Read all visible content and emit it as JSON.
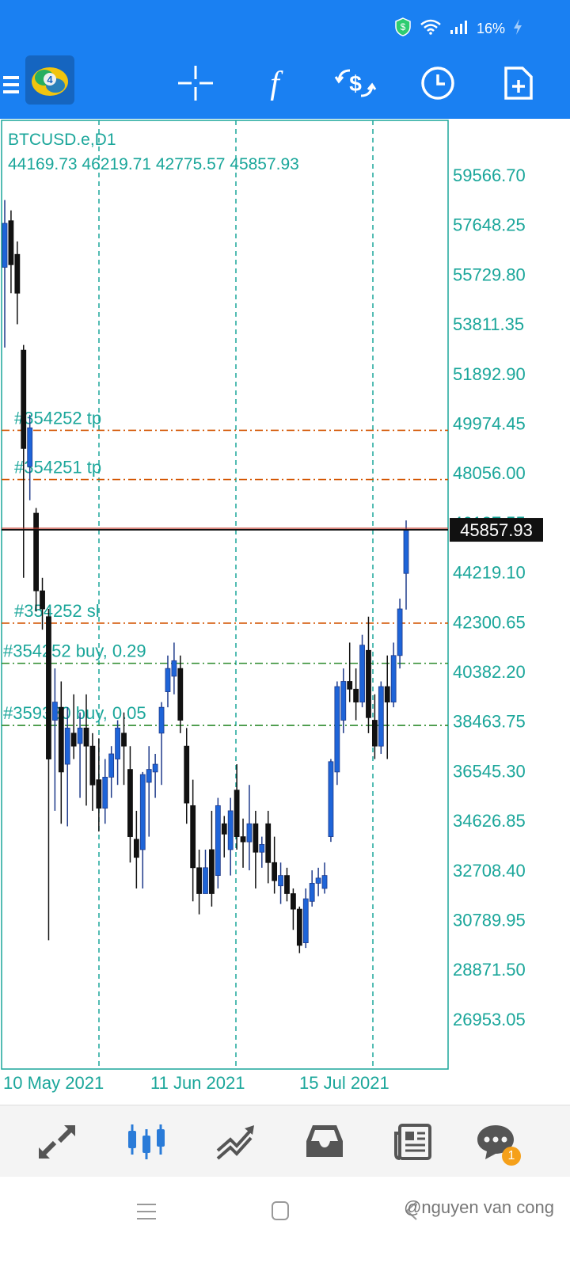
{
  "status_bar": {
    "battery": "16%"
  },
  "chart": {
    "symbol": "BTCUSD.e,D1",
    "ohlc": "44169.73 46219.71 42775.57 45857.93",
    "price_labels": [
      "59566.70",
      "57648.25",
      "55729.80",
      "53811.35",
      "51892.90",
      "49974.45",
      "48056.00",
      "46137.55",
      "44219.10",
      "42300.65",
      "40382.20",
      "38463.75",
      "36545.30",
      "34626.85",
      "32708.40",
      "30789.95",
      "28871.50",
      "26953.05"
    ],
    "current_price": "45857.93",
    "date_labels": [
      "10 May 2021",
      "11 Jun 2021",
      "15 Jul 2021"
    ],
    "trade_lines": [
      {
        "label": "#354252 tp",
        "kind": "tp"
      },
      {
        "label": "#354251 tp",
        "kind": "tp"
      },
      {
        "label": "#354252 sl",
        "kind": "sl"
      },
      {
        "label": "#354252 buy, 0.29",
        "kind": "entry"
      },
      {
        "label": "#359380 buy, 0.05",
        "kind": "entry"
      }
    ],
    "colors": {
      "axis": "#1aa69a",
      "bull": "#1e64d8",
      "bear": "#111111",
      "tp": "#d35400",
      "entry": "#2e8b2e",
      "price_line": "#c0392b"
    }
  },
  "chart_data": {
    "type": "candlestick",
    "title": "BTCUSD.e,D1",
    "xlabel": "",
    "ylabel": "",
    "ylim": [
      25000,
      61500
    ],
    "x_ticks": [
      "10 May 2021",
      "11 Jun 2021",
      "15 Jul 2021"
    ],
    "y_ticks": [
      59566.7,
      57648.25,
      55729.8,
      53811.35,
      51892.9,
      49974.45,
      48056.0,
      46137.55,
      44219.1,
      42300.65,
      40382.2,
      38463.75,
      36545.3,
      34626.85,
      32708.4,
      30789.95,
      28871.5,
      26953.05
    ],
    "last_price": 45857.93,
    "grid": true,
    "candles": [
      {
        "o": 56000,
        "h": 58600,
        "l": 52900,
        "c": 57700
      },
      {
        "o": 57800,
        "h": 58200,
        "l": 55000,
        "c": 56100
      },
      {
        "o": 56500,
        "h": 57000,
        "l": 53800,
        "c": 55000
      },
      {
        "o": 52800,
        "h": 53000,
        "l": 44000,
        "c": 49000
      },
      {
        "o": 48300,
        "h": 50300,
        "l": 47000,
        "c": 49800
      },
      {
        "o": 46500,
        "h": 46700,
        "l": 42700,
        "c": 43500
      },
      {
        "o": 43500,
        "h": 44000,
        "l": 42000,
        "c": 42800
      },
      {
        "o": 42500,
        "h": 42800,
        "l": 30000,
        "c": 37000
      },
      {
        "o": 38500,
        "h": 40500,
        "l": 35000,
        "c": 39200
      },
      {
        "o": 39000,
        "h": 40000,
        "l": 34500,
        "c": 36500
      },
      {
        "o": 36800,
        "h": 39000,
        "l": 34400,
        "c": 38200
      },
      {
        "o": 38000,
        "h": 39500,
        "l": 37000,
        "c": 37500
      },
      {
        "o": 37600,
        "h": 38800,
        "l": 35500,
        "c": 38200
      },
      {
        "o": 38200,
        "h": 39500,
        "l": 35200,
        "c": 37500
      },
      {
        "o": 37500,
        "h": 38000,
        "l": 35000,
        "c": 36000
      },
      {
        "o": 36200,
        "h": 37800,
        "l": 34200,
        "c": 35100
      },
      {
        "o": 35100,
        "h": 37000,
        "l": 34500,
        "c": 36300
      },
      {
        "o": 36300,
        "h": 37500,
        "l": 35500,
        "c": 37200
      },
      {
        "o": 37000,
        "h": 38500,
        "l": 36000,
        "c": 38200
      },
      {
        "o": 38000,
        "h": 38800,
        "l": 36000,
        "c": 37500
      },
      {
        "o": 36600,
        "h": 37500,
        "l": 33000,
        "c": 34000
      },
      {
        "o": 33900,
        "h": 35000,
        "l": 32000,
        "c": 33200
      },
      {
        "o": 33500,
        "h": 36500,
        "l": 32000,
        "c": 36400
      },
      {
        "o": 36100,
        "h": 37500,
        "l": 34000,
        "c": 36600
      },
      {
        "o": 36500,
        "h": 37200,
        "l": 35500,
        "c": 36800
      },
      {
        "o": 38000,
        "h": 39200,
        "l": 36000,
        "c": 39000
      },
      {
        "o": 39600,
        "h": 41000,
        "l": 39000,
        "c": 40500
      },
      {
        "o": 40200,
        "h": 41500,
        "l": 39500,
        "c": 40800
      },
      {
        "o": 40500,
        "h": 41000,
        "l": 38000,
        "c": 38500
      },
      {
        "o": 37500,
        "h": 38200,
        "l": 34500,
        "c": 35300
      },
      {
        "o": 35200,
        "h": 36200,
        "l": 31500,
        "c": 32800
      },
      {
        "o": 32800,
        "h": 33500,
        "l": 31000,
        "c": 31800
      },
      {
        "o": 31800,
        "h": 33500,
        "l": 31800,
        "c": 32800
      },
      {
        "o": 33500,
        "h": 35000,
        "l": 31300,
        "c": 31800
      },
      {
        "o": 32500,
        "h": 35500,
        "l": 32000,
        "c": 35200
      },
      {
        "o": 34500,
        "h": 34800,
        "l": 33200,
        "c": 34100
      },
      {
        "o": 33500,
        "h": 35500,
        "l": 32500,
        "c": 35000
      },
      {
        "o": 35800,
        "h": 36800,
        "l": 33500,
        "c": 34000
      },
      {
        "o": 34000,
        "h": 34700,
        "l": 32800,
        "c": 33800
      },
      {
        "o": 33800,
        "h": 36000,
        "l": 32700,
        "c": 34500
      },
      {
        "o": 34500,
        "h": 35000,
        "l": 32000,
        "c": 33400
      },
      {
        "o": 33400,
        "h": 34000,
        "l": 32800,
        "c": 33700
      },
      {
        "o": 34500,
        "h": 35000,
        "l": 32200,
        "c": 33000
      },
      {
        "o": 33000,
        "h": 34000,
        "l": 31800,
        "c": 32300
      },
      {
        "o": 32100,
        "h": 33000,
        "l": 31400,
        "c": 32500
      },
      {
        "o": 32500,
        "h": 32800,
        "l": 31500,
        "c": 31800
      },
      {
        "o": 31800,
        "h": 32000,
        "l": 30400,
        "c": 31200
      },
      {
        "o": 31200,
        "h": 31300,
        "l": 29500,
        "c": 29800
      },
      {
        "o": 29900,
        "h": 32000,
        "l": 29700,
        "c": 31600
      },
      {
        "o": 31500,
        "h": 32700,
        "l": 31300,
        "c": 32200
      },
      {
        "o": 32200,
        "h": 32800,
        "l": 31700,
        "c": 32400
      },
      {
        "o": 32000,
        "h": 33000,
        "l": 31800,
        "c": 32500
      },
      {
        "o": 34000,
        "h": 37000,
        "l": 33800,
        "c": 36900
      },
      {
        "o": 36500,
        "h": 40000,
        "l": 36000,
        "c": 39800
      },
      {
        "o": 38500,
        "h": 40500,
        "l": 38000,
        "c": 40000
      },
      {
        "o": 40000,
        "h": 41500,
        "l": 39200,
        "c": 39700
      },
      {
        "o": 39700,
        "h": 40500,
        "l": 38500,
        "c": 39200
      },
      {
        "o": 39200,
        "h": 41800,
        "l": 39000,
        "c": 41400
      },
      {
        "o": 41200,
        "h": 42500,
        "l": 38000,
        "c": 38600
      },
      {
        "o": 38500,
        "h": 39500,
        "l": 37000,
        "c": 37500
      },
      {
        "o": 37500,
        "h": 40000,
        "l": 37200,
        "c": 39800
      },
      {
        "o": 39800,
        "h": 41000,
        "l": 37000,
        "c": 39200
      },
      {
        "o": 39200,
        "h": 41500,
        "l": 39000,
        "c": 41000
      },
      {
        "o": 41000,
        "h": 43200,
        "l": 40500,
        "c": 42800
      },
      {
        "o": 44169.73,
        "h": 46219.71,
        "l": 42775.57,
        "c": 45857.93
      }
    ],
    "levels": [
      {
        "name": "#354252 tp",
        "value": 49700,
        "kind": "tp"
      },
      {
        "name": "#354251 tp",
        "value": 47800,
        "kind": "tp"
      },
      {
        "name": "#354252 sl",
        "value": 42250,
        "kind": "sl"
      },
      {
        "name": "#354252 buy, 0.29",
        "value": 40700,
        "kind": "entry"
      },
      {
        "name": "#359380 buy, 0.05",
        "value": 38300,
        "kind": "entry"
      }
    ]
  },
  "bottom_nav": {
    "items": [
      "quotes-icon",
      "chart-icon",
      "trade-icon",
      "history-icon",
      "news-icon",
      "messages-icon"
    ],
    "badge": "1"
  },
  "watermark": "@nguyen van cong"
}
